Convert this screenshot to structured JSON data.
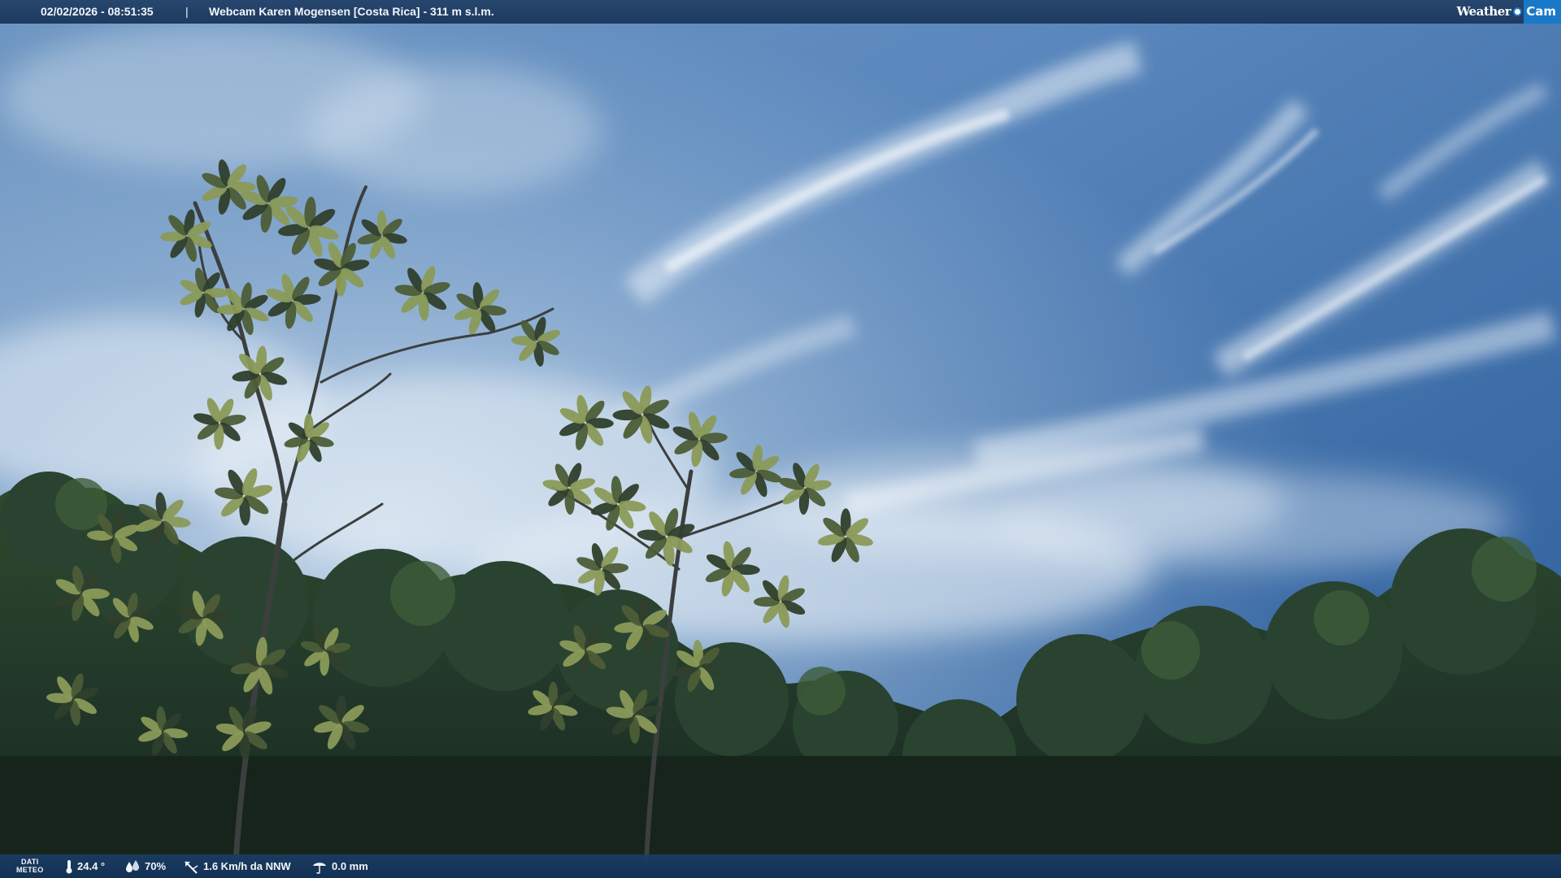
{
  "header": {
    "datetime": "02/02/2026 - 08:51:35",
    "separator": "|",
    "title": "Webcam Karen Mogensen [Costa Rica]  - 311 m s.l.m.",
    "logo_weather": "Weather",
    "logo_cam": "Cam"
  },
  "footer": {
    "meteo_label_line1": "DATI",
    "meteo_label_line2": "METEO",
    "temperature": "24.4 °",
    "humidity": "70%",
    "wind": "1.6 Km/h da NNW",
    "rain": "0.0 mm"
  },
  "colors": {
    "bar": "#1f3d63",
    "logo_accent": "#1a78c8",
    "sky_top": "#3a6fa8",
    "sky_light": "#b9cfe2",
    "foliage_dark": "#1f2e22"
  },
  "icons": {
    "temperature": "thermometer-icon",
    "humidity": "drops-icon",
    "wind": "wind-vane-icon",
    "rain": "rain-gauge-icon"
  }
}
